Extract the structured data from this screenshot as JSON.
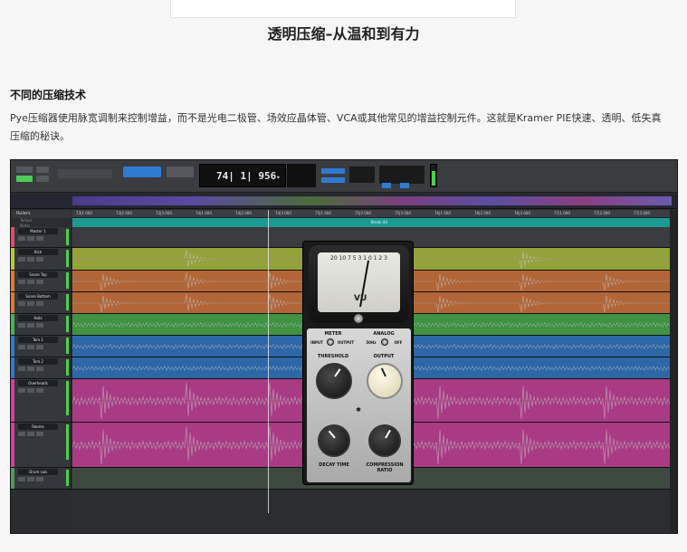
{
  "article": {
    "title": "透明压缩–从温和到有力",
    "section_heading": "不同的压缩技术",
    "paragraph": "Pye压缩器使用脉宽调制来控制增益，而不是光电二极管、场效应晶体管、VCA或其他常见的增益控制元件。这就是Kramer PIE快速、透明、低失真压缩的秘诀。"
  },
  "daw": {
    "counter": "74| 1| 956",
    "counter_arrow": "▾",
    "ruler_ticks": [
      "73|1 000",
      "73|2 000",
      "73|3 000",
      "74|1 000",
      "74|2 000",
      "74|3 000",
      "75|1 000",
      "75|2 000",
      "75|3 000",
      "76|1 000",
      "76|2 000",
      "76|3 000",
      "77|1 000",
      "77|2 000",
      "77|3 000"
    ],
    "marker_label": "Break 44",
    "timeline_header": "Rulers",
    "timeline_rows": [
      "Tempo",
      "Meter",
      "Markers"
    ],
    "tracks": [
      {
        "name": "Master 1",
        "color": "#e24a6a",
        "waveform": "none"
      },
      {
        "name": "Kick",
        "color": "#b8c93e",
        "waveform": "kick"
      },
      {
        "name": "Snare Top",
        "color": "#e0783a",
        "waveform": "snare"
      },
      {
        "name": "Snare Bottom",
        "color": "#e0783a",
        "waveform": "snare"
      },
      {
        "name": "Hats",
        "color": "#46b64a",
        "waveform": "hats"
      },
      {
        "name": "Tom 1",
        "color": "#2e7bd0",
        "waveform": "tom"
      },
      {
        "name": "Tom 2",
        "color": "#2e7bd0",
        "waveform": "tom"
      },
      {
        "name": "Overheads",
        "color": "#d43fa0",
        "waveform": "overheads"
      },
      {
        "name": "Rooms",
        "color": "#d43fa0",
        "waveform": "rooms"
      },
      {
        "name": "Drum sub",
        "color": "#4c9b5a",
        "waveform": "none"
      }
    ]
  },
  "plugin": {
    "vu_label": "VU",
    "vu_scale": "20 10 7 5 3 1 0 1 2 3",
    "meter_label": "METER",
    "meter_options": [
      "INPUT",
      "OUTPUT"
    ],
    "analog_label": "ANALOG",
    "analog_options": [
      "50Hz",
      "OFF"
    ],
    "threshold_label": "THRESHOLD",
    "output_label": "OUTPUT",
    "decay_label": "DECAY TIME",
    "ratio_label": "COMPRESSION RATIO"
  }
}
